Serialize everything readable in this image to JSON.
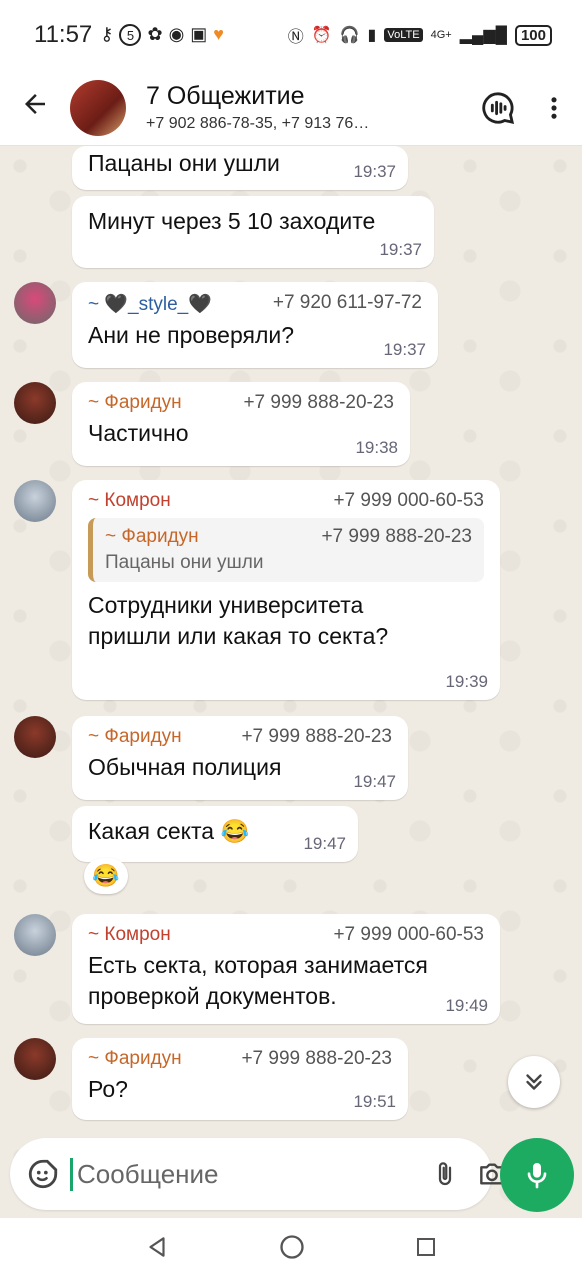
{
  "status": {
    "time": "11:57",
    "battery": "100",
    "network": "4G+",
    "volte": "VoLTE",
    "sim_badge": "5"
  },
  "header": {
    "title": "7 Общежитие",
    "subtitle": "+7 902 886-78-35, +7 913 76…"
  },
  "messages": [
    {
      "text": "Пацаны они ушли",
      "time": "19:37"
    },
    {
      "text": "Минут через 5 10 заходите",
      "time": "19:37"
    },
    {
      "sender": "~ 🖤_style_🖤",
      "phone": "+7 920 611-97-72",
      "text": "Ани не проверяли?",
      "time": "19:37"
    },
    {
      "sender": "~ Фаридун",
      "phone": "+7 999 888-20-23",
      "text": "Частично",
      "time": "19:38"
    },
    {
      "sender": "~ Комрон",
      "phone": "+7 999 000-60-53",
      "quote": {
        "sender": "~ Фаридун",
        "phone": "+7 999 888-20-23",
        "text": "Пацаны они ушли"
      },
      "text_line1": "Сотрудники университета",
      "text_line2": "пришли или какая то секта?",
      "time": "19:39"
    },
    {
      "sender": "~ Фаридун",
      "phone": "+7 999 888-20-23",
      "text": "Обычная полиция",
      "time": "19:47"
    },
    {
      "text": "Какая секта 😂",
      "time": "19:47",
      "reaction": "😂"
    },
    {
      "sender": "~ Комрон",
      "phone": "+7 999 000-60-53",
      "text_line1": "Есть секта, которая занимается",
      "text_line2": "проверкой документов.",
      "time": "19:49"
    },
    {
      "sender": "~ Фаридун",
      "phone": "+7 999 888-20-23",
      "text": "Ро?",
      "time": "19:51"
    }
  ],
  "composer": {
    "placeholder": "Сообщение"
  },
  "colors": {
    "accent": "#1daa61",
    "bubble": "#ffffff",
    "wallpaper": "#efeae2"
  }
}
